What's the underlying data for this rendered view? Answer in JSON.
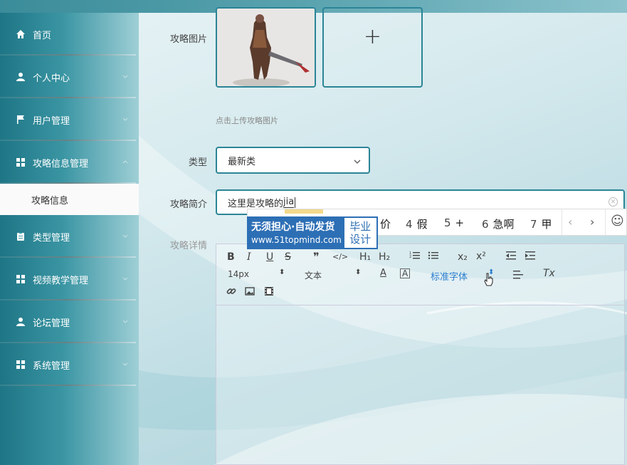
{
  "sidebar": {
    "items": [
      {
        "label": "首页",
        "icon": "home-icon",
        "has_children": false
      },
      {
        "label": "个人中心",
        "icon": "user-icon",
        "has_children": true
      },
      {
        "label": "用户管理",
        "icon": "flag-icon",
        "has_children": true
      },
      {
        "label": "攻略信息管理",
        "icon": "grid-icon",
        "has_children": true
      },
      {
        "label": "类型管理",
        "icon": "clipboard-icon",
        "has_children": true
      },
      {
        "label": "视频教学管理",
        "icon": "grid-icon",
        "has_children": true
      },
      {
        "label": "论坛管理",
        "icon": "user-icon",
        "has_children": true
      },
      {
        "label": "系统管理",
        "icon": "grid-icon",
        "has_children": true
      }
    ],
    "active_submenu": "攻略信息"
  },
  "form": {
    "image_label": "攻略图片",
    "upload_hint": "点击上传攻略图片",
    "upload_plus": "+",
    "type_label": "类型",
    "type_value": "最新类",
    "intro_label": "攻略简介",
    "intro_value_prefix": "这里是攻略的",
    "intro_value_composing": "jia",
    "detail_label": "攻略详情"
  },
  "ime": {
    "candidates": [
      {
        "num": "",
        "text": "价"
      },
      {
        "num": "4",
        "text": "假"
      },
      {
        "num": "5",
        "text": "+"
      },
      {
        "num": "6",
        "text": "急啊"
      },
      {
        "num": "7",
        "text": "甲"
      }
    ],
    "prev": "‹",
    "next": "›",
    "emoji": "☺"
  },
  "watermark": {
    "line1": "无须担心·自动发货",
    "line2": "www.51topmind.com",
    "badge_top": "毕业",
    "badge_bottom": "设计"
  },
  "editor": {
    "font_size": "14px",
    "text_type": "文本",
    "font_family": "标准字体",
    "buttons": {
      "bold": "B",
      "italic": "I",
      "underline": "U",
      "strike": "S",
      "quote": "❞",
      "code": "</>",
      "h1": "H₁",
      "h2": "H₂",
      "sub": "x₂",
      "sup": "x²",
      "clear": "Tx"
    }
  },
  "colors": {
    "accent": "#2b8596",
    "sidebar_dark": "#1e7585",
    "watermark_blue": "#2d6fb5"
  }
}
